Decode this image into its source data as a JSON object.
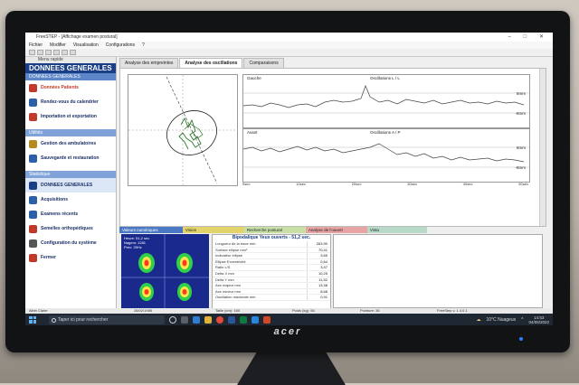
{
  "window": {
    "title": "FreeSTEP - [Affichage examen postural]",
    "controls": "–  □  ✕"
  },
  "menubar": [
    "Fichier",
    "Modifier",
    "Visualisation",
    "Configurations",
    "?"
  ],
  "sidebar": {
    "menu_rapide": "Menu rapide",
    "section_main": "DONNEES GENERALES",
    "section_main_sub": "DONNEES GENERALES",
    "items_top": [
      {
        "label": "Données Patients",
        "icon": "patient-icon",
        "color": "#c0392b"
      },
      {
        "label": "Rendez-vous du calendrier",
        "icon": "calendar-icon",
        "color": "#2c5fa8"
      },
      {
        "label": "Importation et exportation",
        "icon": "import-export-icon",
        "color": "#c0392b"
      }
    ],
    "section_utilities": "Utilités",
    "items_mid": [
      {
        "label": "Gestion des ambulatoires",
        "icon": "ambulatory-icon",
        "color": "#b58a1e"
      },
      {
        "label": "Sauvegarde et restauration",
        "icon": "backup-icon",
        "color": "#2c5fa8"
      }
    ],
    "section_stats": "Statistique",
    "section_general": "DONNEES GENERALES",
    "items_bottom": [
      {
        "label": "Acquisitions",
        "icon": "acquisition-icon",
        "color": "#2c5fa8"
      },
      {
        "label": "Examens récents",
        "icon": "recent-exams-icon",
        "color": "#2c5fa8"
      },
      {
        "label": "Semelles orthopédiques",
        "icon": "insole-icon",
        "color": "#c0392b"
      },
      {
        "label": "Configuration du système",
        "icon": "system-config-icon",
        "color": "#555555"
      },
      {
        "label": "Fermer",
        "icon": "close-app-icon",
        "color": "#c0392b"
      }
    ]
  },
  "main_tabs": [
    "Analyse des empreintes",
    "Analyse des oscillations",
    "Comparaisons"
  ],
  "graphs": [
    {
      "title_left": "Gauche",
      "title_center": "Oscillations L / L",
      "label_right_top": "8mm",
      "label_right_bottom": "-8mm"
    },
    {
      "title_left": "Avant",
      "title_center": "Oscillations A / P",
      "label_right_top": "8mm",
      "label_right_bottom": "-8mm"
    }
  ],
  "axis_ticks": [
    "0sec",
    "10sec",
    "20sec",
    "30sec",
    "40sec",
    "50sec"
  ],
  "bottom_tabs": [
    {
      "label": "Valeurs numériques",
      "color": "#4a78c4"
    },
    {
      "label": "Vision",
      "color": "#e2d36b"
    },
    {
      "label": "Recherche postural",
      "color": "#c8e0a5"
    },
    {
      "label": "Analyse de l'ouvert",
      "color": "#e8a3a3"
    },
    {
      "label": "Vista",
      "color": "#b8d8c8"
    }
  ],
  "foot_image": {
    "line1": "Heure: 51,2 sec",
    "line2": "Nagem: 1281",
    "line3": "Prec: 25Hz"
  },
  "stats": {
    "header": "Bipodalique Yeux ouverts - 51,2 sec.",
    "rows": [
      {
        "k": "Longueur de la trace mm",
        "v": "263,90"
      },
      {
        "k": "Surface ellipse mm²",
        "v": "70,41"
      },
      {
        "k": "Indicateur ellipse",
        "v": "3,65"
      },
      {
        "k": "Ellipse Excentricité",
        "v": "0,64"
      },
      {
        "k": "Ratio L/S",
        "v": "3,47"
      },
      {
        "k": "Delta X mm",
        "v": "10,25"
      },
      {
        "k": "Delta Y mm",
        "v": "11,52"
      },
      {
        "k": "Axe majeur mm",
        "v": "13,38"
      },
      {
        "k": "Axe mineur mm",
        "v": "8,68"
      },
      {
        "k": "Oscillation maximale mm",
        "v": "0,91"
      }
    ]
  },
  "statusbar": [
    "Albin Claire",
    "28/02/1985",
    "Taille (cm): 160",
    "Poids (kg): 56",
    "Pointure: 36",
    "FreeStep v. 1.4.0.1"
  ],
  "taskbar": {
    "search_placeholder": "Taper ici pour rechercher",
    "weather": "10°C Nuageux",
    "time": "14:53",
    "date": "04/05/2022"
  },
  "monitor_brand": "acer"
}
